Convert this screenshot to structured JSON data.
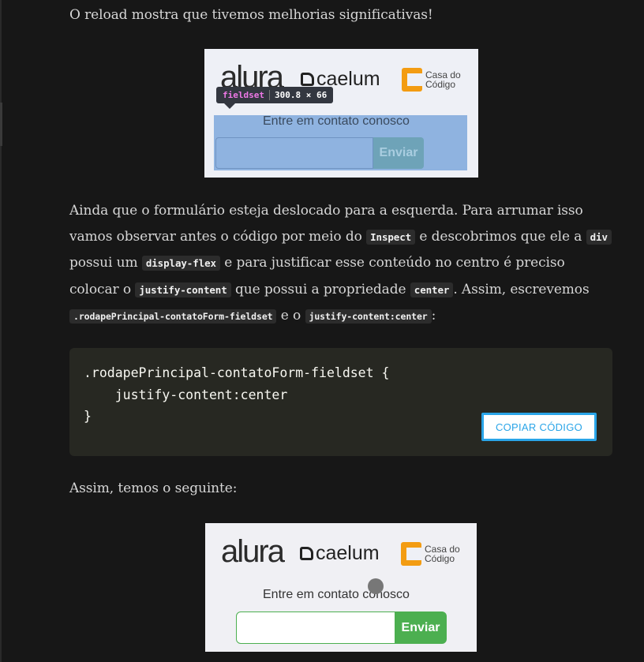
{
  "article": {
    "p1": "O reload mostra que tivemos melhorias significativas!",
    "p2": {
      "t1": "Ainda que o formulário esteja deslocado para a esquerda. Para arrumar isso vamos observar antes o código por meio do ",
      "c1": "Inspect",
      "t2": " e descobrimos que ele a ",
      "c2": "div",
      "t3": " possui um ",
      "c3": "display-flex",
      "t4": " e para justificar esse conteúdo no centro é preciso colocar o ",
      "c4": "justify-content",
      "t5": " que possui a propriedade ",
      "c5": "center",
      "t6": ". Assim, escrevemos ",
      "c6": ".rodapePrincipal-contatoForm-fieldset",
      "t7": " e o ",
      "c7": "justify-content:center",
      "t8": ":"
    },
    "code": ".rodapePrincipal-contatoForm-fieldset {\n    justify-content:center\n}",
    "copy_label": "COPIAR CÓDIGO",
    "p3": "Assim, temos o seguinte:"
  },
  "screenshot1": {
    "logo_alura": "alura",
    "logo_caelum": "caelum",
    "logo_cdc_line1": "Casa do",
    "logo_cdc_line2": "Código",
    "tooltip_tag": "fieldset",
    "tooltip_size": "300.8 × 66",
    "form_title": "Entre em contato conosco",
    "button": "Enviar",
    "highlight_color": "#8fb3e0"
  },
  "screenshot2": {
    "logo_alura": "alura",
    "logo_caelum": "caelum",
    "logo_cdc_line1": "Casa do",
    "logo_cdc_line2": "Código",
    "form_title": "Entre em contato conosco",
    "button": "Enviar",
    "button_color": "#4caf50"
  }
}
